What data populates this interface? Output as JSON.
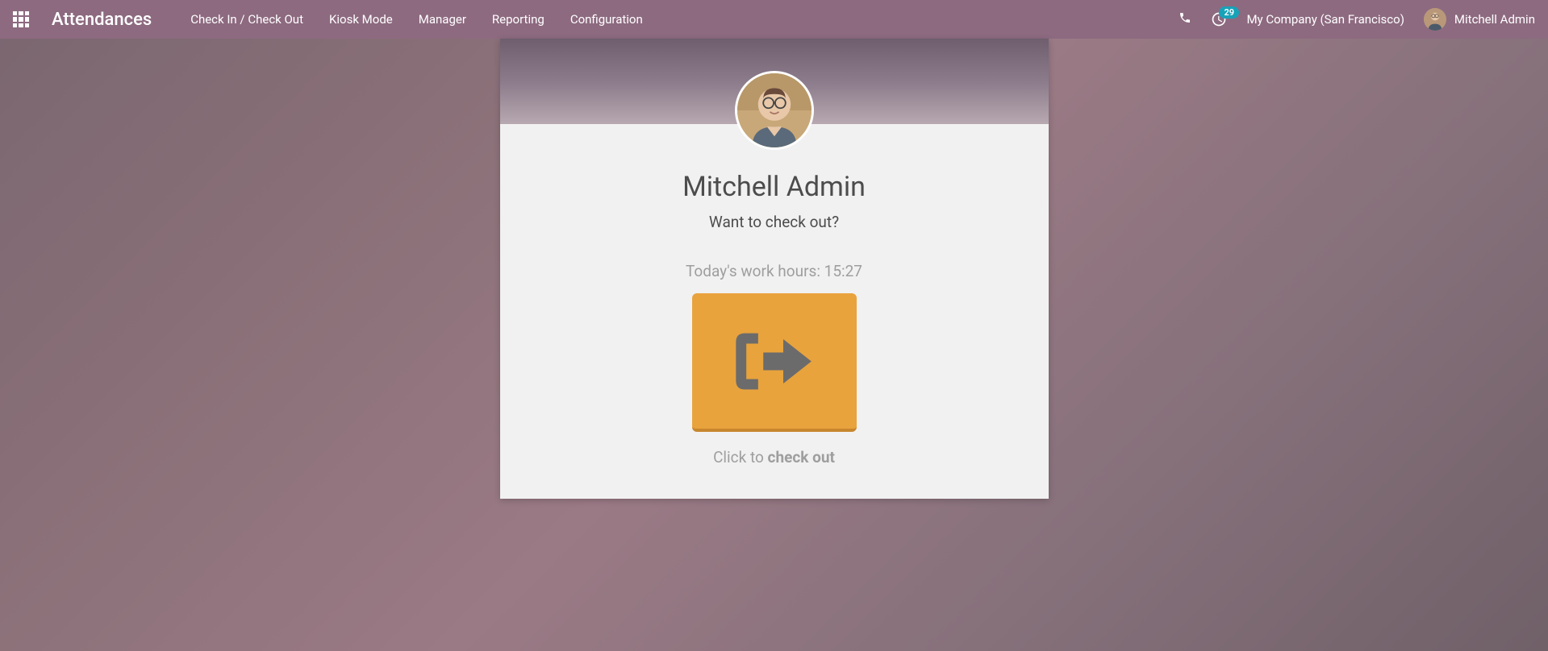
{
  "navbar": {
    "brand": "Attendances",
    "links": [
      "Check In / Check Out",
      "Kiosk Mode",
      "Manager",
      "Reporting",
      "Configuration"
    ],
    "badge_count": "29",
    "company": "My Company (San Francisco)",
    "user_name": "Mitchell Admin"
  },
  "card": {
    "employee_name": "Mitchell Admin",
    "prompt": "Want to check out?",
    "work_hours_label": "Today's work hours: ",
    "work_hours_value": "15:27",
    "click_hint_prefix": "Click to ",
    "click_hint_bold": "check out"
  }
}
